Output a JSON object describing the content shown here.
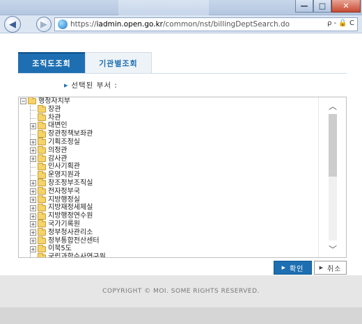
{
  "browser": {
    "url_scheme": "https://",
    "url_host": "iadmin.open.go.kr",
    "url_path": "/common/nst/billingDeptSearch.do",
    "url_tools": "ρ - 🔒 C",
    "window_buttons": {
      "minimize": "—",
      "maximize": "□",
      "close": "✕"
    }
  },
  "tabs": [
    {
      "label": "조직도조회",
      "active": true
    },
    {
      "label": "기관별조회",
      "active": false
    }
  ],
  "selected_dept_label": "선택된 부서 :",
  "tree": {
    "root": {
      "label": "행정자치부",
      "expander": "⊟"
    },
    "children": [
      {
        "label": "장관",
        "expander": ""
      },
      {
        "label": "차관",
        "expander": ""
      },
      {
        "label": "대변인",
        "expander": "⊞"
      },
      {
        "label": "장관정책보좌관",
        "expander": ""
      },
      {
        "label": "기획조정실",
        "expander": "⊞"
      },
      {
        "label": "의정관",
        "expander": "⊞"
      },
      {
        "label": "감사관",
        "expander": "⊞"
      },
      {
        "label": "인사기획관",
        "expander": ""
      },
      {
        "label": "운영지원과",
        "expander": ""
      },
      {
        "label": "창조정부조직실",
        "expander": "⊞"
      },
      {
        "label": "전자정부국",
        "expander": "⊞"
      },
      {
        "label": "지방행정실",
        "expander": "⊞"
      },
      {
        "label": "지방재정세제실",
        "expander": "⊞"
      },
      {
        "label": "지방행정연수원",
        "expander": "⊞"
      },
      {
        "label": "국가기록원",
        "expander": "⊞"
      },
      {
        "label": "정부청사관리소",
        "expander": "⊞"
      },
      {
        "label": "정부통합전산센터",
        "expander": "⊞"
      },
      {
        "label": "이북5도",
        "expander": "⊞"
      },
      {
        "label": "국립과학수사연구원",
        "expander": ""
      }
    ]
  },
  "buttons": {
    "ok": "확인",
    "cancel": "취소"
  },
  "footer": "COPYRIGHT © MOI. SOME RIGHTS RESERVED.",
  "colors": {
    "accent": "#1d6fb2",
    "folder": "#f5d36a",
    "footer_bg": "#e6e6e6"
  }
}
